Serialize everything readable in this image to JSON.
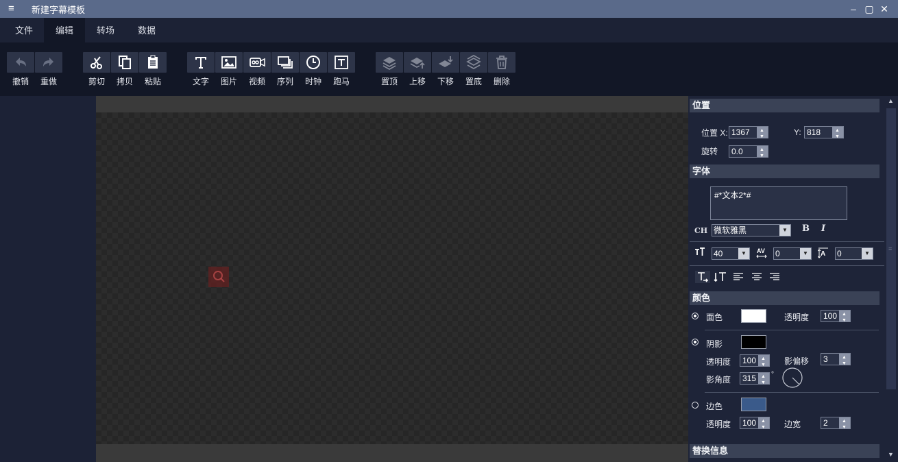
{
  "window": {
    "title": "新建字幕模板",
    "menu_icon": "hamburger-icon"
  },
  "menu": {
    "tabs": [
      "文件",
      "编辑",
      "转场",
      "数据"
    ],
    "active": "编辑"
  },
  "toolbar": {
    "undo": "撤销",
    "redo": "重做",
    "cut": "剪切",
    "copy": "拷贝",
    "paste": "粘贴",
    "text": "文字",
    "image": "图片",
    "video": "视频",
    "sequence": "序列",
    "clock": "时钟",
    "marquee": "跑马",
    "top": "置顶",
    "up": "上移",
    "down": "下移",
    "bottom": "置底",
    "delete": "删除"
  },
  "position": {
    "header": "位置",
    "x_label": "位置 X:",
    "x_value": "1367",
    "y_label": "Y:",
    "y_value": "818",
    "rotate_label": "旋转",
    "rotate_value": "0.0"
  },
  "font": {
    "header": "字体",
    "text": "#*文本2*#",
    "ch_label": "CH",
    "family": "微软雅黑",
    "bold": "B",
    "italic": "I",
    "size": "40",
    "spacing": "0",
    "line_spacing": "0"
  },
  "color": {
    "header": "颜色",
    "face_label": "面色",
    "face_color": "#ffffff",
    "face_opacity_label": "透明度",
    "face_opacity": "100",
    "shadow_label": "阴影",
    "shadow_color": "#000000",
    "shadow_opacity_label": "透明度",
    "shadow_opacity": "100",
    "shadow_offset_label": "影偏移",
    "shadow_offset": "3",
    "shadow_angle_label": "影角度",
    "shadow_angle": "315",
    "degree": "°",
    "border_label": "边色",
    "border_color": "#3a5a8a",
    "border_opacity_label": "透明度",
    "border_opacity": "100",
    "border_width_label": "边宽",
    "border_width": "2"
  },
  "replace": {
    "header": "替换信息"
  }
}
